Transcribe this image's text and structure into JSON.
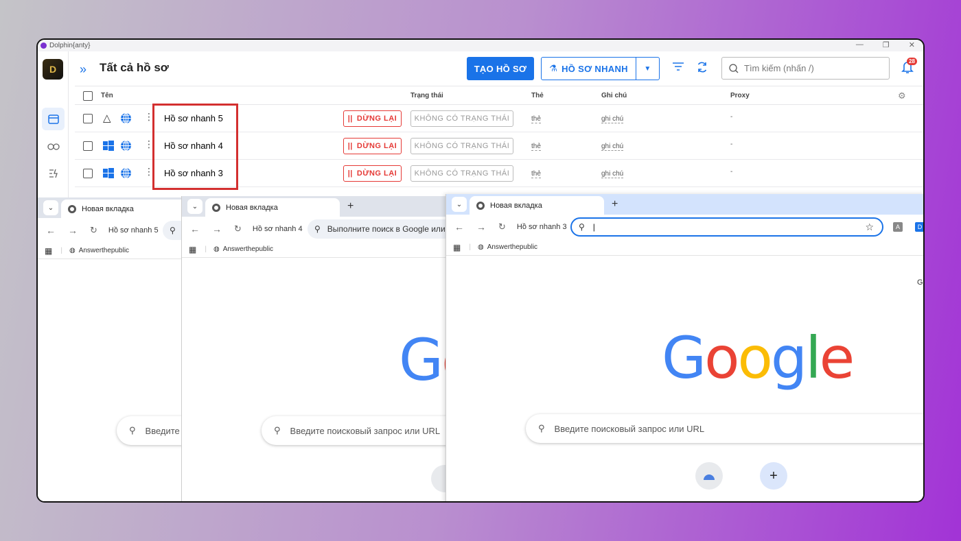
{
  "dolphin": {
    "window_title": "Dolphin{anty}",
    "page_title": "Tất cả hồ sơ",
    "create_btn": "TẠO HỒ SƠ",
    "quick_btn": "HỒ SƠ NHANH",
    "search_placeholder": "Tìm kiếm (nhấn /)",
    "notif_count": "28",
    "columns": {
      "name": "Tên",
      "status": "Trạng thái",
      "tag": "Thẻ",
      "note": "Ghi chú",
      "proxy": "Proxy"
    },
    "rows": [
      {
        "name": "Hồ sơ nhanh 5",
        "os": "linux",
        "stop": "DỪNG LẠI",
        "status": "KHÔNG CÓ TRẠNG THÁI",
        "tag": "thẻ",
        "note": "ghi chú",
        "proxy": "-"
      },
      {
        "name": "Hồ sơ nhanh 4",
        "os": "windows",
        "stop": "DỪNG LẠI",
        "status": "KHÔNG CÓ TRẠNG THÁI",
        "tag": "thẻ",
        "note": "ghi chú",
        "proxy": "-"
      },
      {
        "name": "Hồ sơ nhanh 3",
        "os": "windows",
        "stop": "DỪNG LẠI",
        "status": "KHÔNG CÓ TRẠNG THÁI",
        "tag": "thẻ",
        "note": "ghi chú",
        "proxy": "-"
      }
    ]
  },
  "browsers": [
    {
      "tab": "Новая вкладка",
      "profile": "Hồ sơ nhanh 5",
      "bookmark": "Answerthepublic",
      "search": "Введите"
    },
    {
      "tab": "Новая вкладка",
      "profile": "Hồ sơ nhanh 4",
      "bookmark": "Answerthepublic",
      "omnibox": "Выполните поиск в Google или",
      "search": "Введите поисковый запрос или URL",
      "logo": "Go"
    },
    {
      "tab": "Новая вкладка",
      "profile": "Hồ sơ nhanh 3",
      "bookmark": "Answerthepublic",
      "search": "Введите поисковый запрос или URL",
      "logo": "Google",
      "corner_text": "G"
    }
  ],
  "colors": {
    "accent": "#1a73e8",
    "danger": "#e53935",
    "highlight": "#d32f2f"
  }
}
